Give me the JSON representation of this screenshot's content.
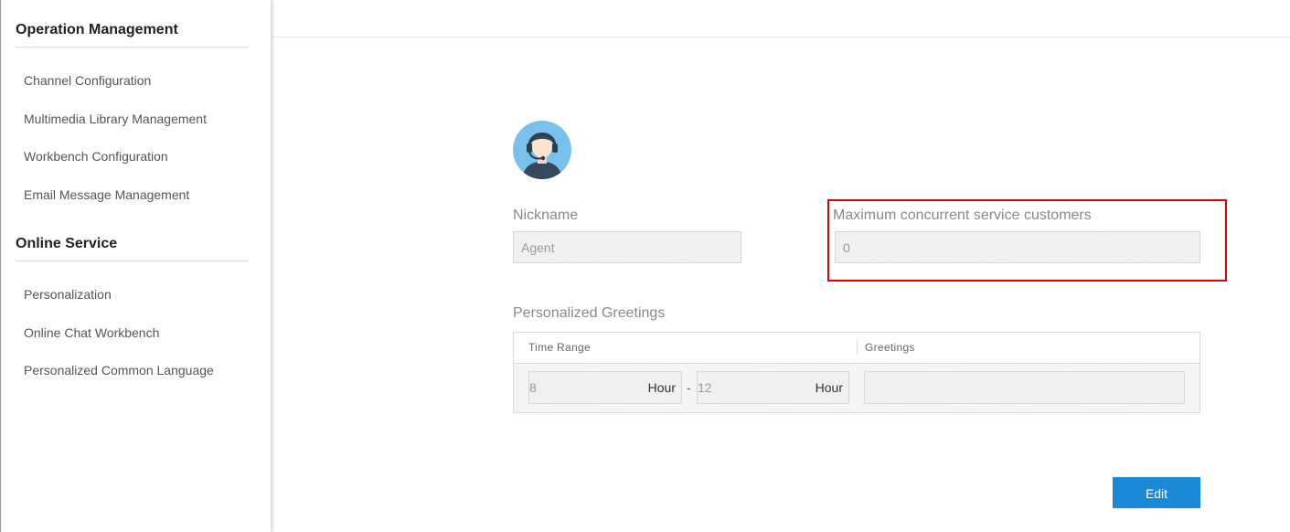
{
  "sidebar": {
    "sections": [
      {
        "title": "Operation Management",
        "items": [
          {
            "label": "Channel Configuration"
          },
          {
            "label": "Multimedia Library Management"
          },
          {
            "label": "Workbench Configuration"
          },
          {
            "label": "Email Message Management"
          }
        ]
      },
      {
        "title": "Online Service",
        "items": [
          {
            "label": "Personalization"
          },
          {
            "label": "Online Chat Workbench"
          },
          {
            "label": "Personalized Common Language"
          }
        ]
      }
    ]
  },
  "profile": {
    "avatar_icon": "agent-headset-icon",
    "nickname": {
      "label": "Nickname",
      "value": "Agent"
    },
    "max_concurrent": {
      "label": "Maximum concurrent service customers",
      "value": "0"
    }
  },
  "greetings": {
    "title": "Personalized Greetings",
    "columns": [
      "Time Range",
      "Greetings"
    ],
    "rows": [
      {
        "start": "8",
        "start_unit": "Hour",
        "separator": "-",
        "end": "12",
        "end_unit": "Hour",
        "greeting": ""
      }
    ]
  },
  "actions": {
    "edit_label": "Edit"
  },
  "colors": {
    "primary": "#1c89d8",
    "highlight": "#e00000",
    "avatar_bg": "#79c1ec"
  }
}
